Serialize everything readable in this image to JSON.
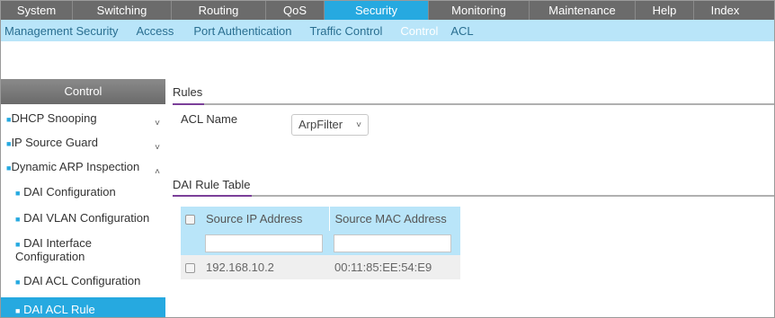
{
  "topnav": {
    "tabs": [
      {
        "label": "System",
        "active": false
      },
      {
        "label": "Switching",
        "active": false
      },
      {
        "label": "Routing",
        "active": false
      },
      {
        "label": "QoS",
        "active": false
      },
      {
        "label": "Security",
        "active": true
      },
      {
        "label": "Monitoring",
        "active": false
      },
      {
        "label": "Maintenance",
        "active": false
      },
      {
        "label": "Help",
        "active": false
      },
      {
        "label": "Index",
        "active": false
      }
    ]
  },
  "subnav": {
    "items": [
      {
        "label": "Management Security",
        "active": false
      },
      {
        "label": "Access",
        "active": false
      },
      {
        "label": "Port Authentication",
        "active": false
      },
      {
        "label": "Traffic Control",
        "active": false
      },
      {
        "label": "Control",
        "active": true
      },
      {
        "label": "ACL",
        "active": false
      }
    ]
  },
  "sidebar": {
    "title": "Control",
    "items": [
      {
        "label": "DHCP Snooping",
        "chevron": "˅"
      },
      {
        "label": "IP Source Guard",
        "chevron": "˅"
      },
      {
        "label": "Dynamic ARP Inspection",
        "chevron": "˄"
      },
      {
        "label": "DAI Configuration"
      },
      {
        "label": "DAI VLAN Configuration"
      },
      {
        "label": "DAI Interface Configuration"
      },
      {
        "label": "DAI ACL Configuration"
      },
      {
        "label": "DAI ACL Rule Configuration",
        "active": true
      }
    ]
  },
  "rules": {
    "title": "Rules",
    "acl_name_label": "ACL Name",
    "acl_name_value": "ArpFilter"
  },
  "dai_table": {
    "title": "DAI Rule Table",
    "columns": [
      "Source IP Address",
      "Source MAC Address"
    ],
    "rows": [
      {
        "ip": "192.168.10.2",
        "mac": "00:11:85:EE:54:E9"
      }
    ]
  },
  "colors": {
    "accent": "#26a9e0",
    "section_accent": "#7b3f99",
    "nav_bg": "#6b6b6b",
    "subnav_bg": "#b9e5f9"
  }
}
